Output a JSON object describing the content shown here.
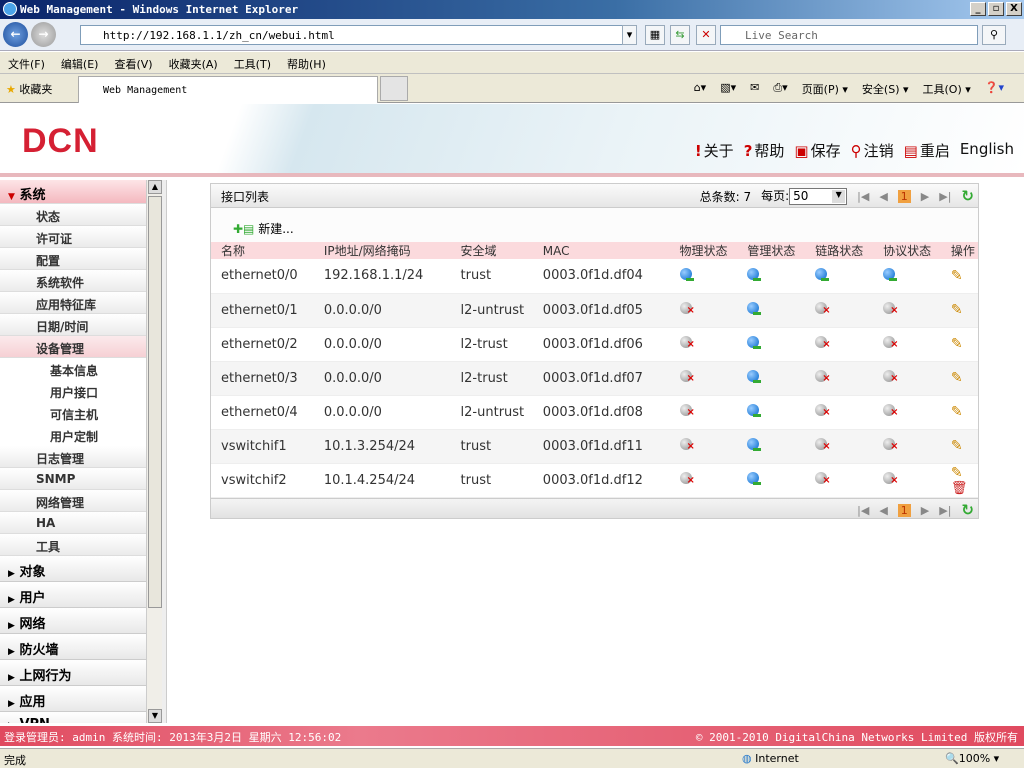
{
  "window": {
    "title": "Web Management - Windows Internet Explorer",
    "min": "_",
    "max": "▫",
    "close": "X"
  },
  "browser": {
    "url": "http://192.168.1.1/zh_cn/webui.html",
    "search_placeholder": "Live Search",
    "menu": [
      "文件(F)",
      "编辑(E)",
      "查看(V)",
      "收藏夹(A)",
      "工具(T)",
      "帮助(H)"
    ],
    "favorites": "收藏夹",
    "tab": "Web Management",
    "commands": [
      "页面(P) ▾",
      "安全(S) ▾",
      "工具(O) ▾"
    ]
  },
  "header": {
    "logo": "DCN",
    "links": [
      {
        "icon": "!",
        "label": "关于"
      },
      {
        "icon": "?",
        "label": "帮助"
      },
      {
        "icon": "▣",
        "label": "保存"
      },
      {
        "icon": "⚲",
        "label": "注销"
      },
      {
        "icon": "▤",
        "label": "重启"
      },
      {
        "icon": "",
        "label": "English"
      }
    ]
  },
  "sidebar": {
    "head": "系统",
    "items": [
      "状态",
      "许可证",
      "配置",
      "系统软件",
      "应用特征库",
      "日期/时间",
      "设备管理"
    ],
    "subitems": [
      "基本信息",
      "用户接口",
      "可信主机",
      "用户定制"
    ],
    "items2": [
      "日志管理",
      "SNMP",
      "网络管理",
      "HA",
      "工具"
    ],
    "groups": [
      "对象",
      "用户",
      "网络",
      "防火墙",
      "上网行为",
      "应用",
      "VPN"
    ]
  },
  "panel": {
    "title": "接口列表",
    "total_label": "总条数: 7",
    "per_page_label": "每页:",
    "per_page": "50",
    "page": "1",
    "new_label": "新建...",
    "columns": [
      "名称",
      "IP地址/网络掩码",
      "安全域",
      "MAC",
      "物理状态",
      "管理状态",
      "链路状态",
      "协议状态",
      "操作"
    ],
    "rows": [
      {
        "name": "ethernet0/0",
        "ip": "192.168.1.1/24",
        "zone": "trust",
        "mac": "0003.0f1d.df04",
        "status": [
          "up",
          "up",
          "up",
          "up"
        ]
      },
      {
        "name": "ethernet0/1",
        "ip": "0.0.0.0/0",
        "zone": "l2-untrust",
        "mac": "0003.0f1d.df05",
        "status": [
          "down",
          "up",
          "down",
          "down"
        ]
      },
      {
        "name": "ethernet0/2",
        "ip": "0.0.0.0/0",
        "zone": "l2-trust",
        "mac": "0003.0f1d.df06",
        "status": [
          "down",
          "up",
          "down",
          "down"
        ]
      },
      {
        "name": "ethernet0/3",
        "ip": "0.0.0.0/0",
        "zone": "l2-trust",
        "mac": "0003.0f1d.df07",
        "status": [
          "down",
          "up",
          "down",
          "down"
        ]
      },
      {
        "name": "ethernet0/4",
        "ip": "0.0.0.0/0",
        "zone": "l2-untrust",
        "mac": "0003.0f1d.df08",
        "status": [
          "down",
          "up",
          "down",
          "down"
        ]
      },
      {
        "name": "vswitchif1",
        "ip": "10.1.3.254/24",
        "zone": "trust",
        "mac": "0003.0f1d.df11",
        "status": [
          "down",
          "up",
          "down",
          "down"
        ]
      },
      {
        "name": "vswitchif2",
        "ip": "10.1.4.254/24",
        "zone": "trust",
        "mac": "0003.0f1d.df12",
        "status": [
          "down",
          "up",
          "down",
          "down"
        ],
        "deletable": true
      }
    ]
  },
  "footer": {
    "left": "登录管理员: admin 系统时间: 2013年3月2日 星期六 12:56:02",
    "right": "© 2001-2010 DigitalChina Networks Limited 版权所有"
  },
  "statusbar": {
    "text": "完成",
    "zone": "Internet",
    "zoom": "100%"
  }
}
